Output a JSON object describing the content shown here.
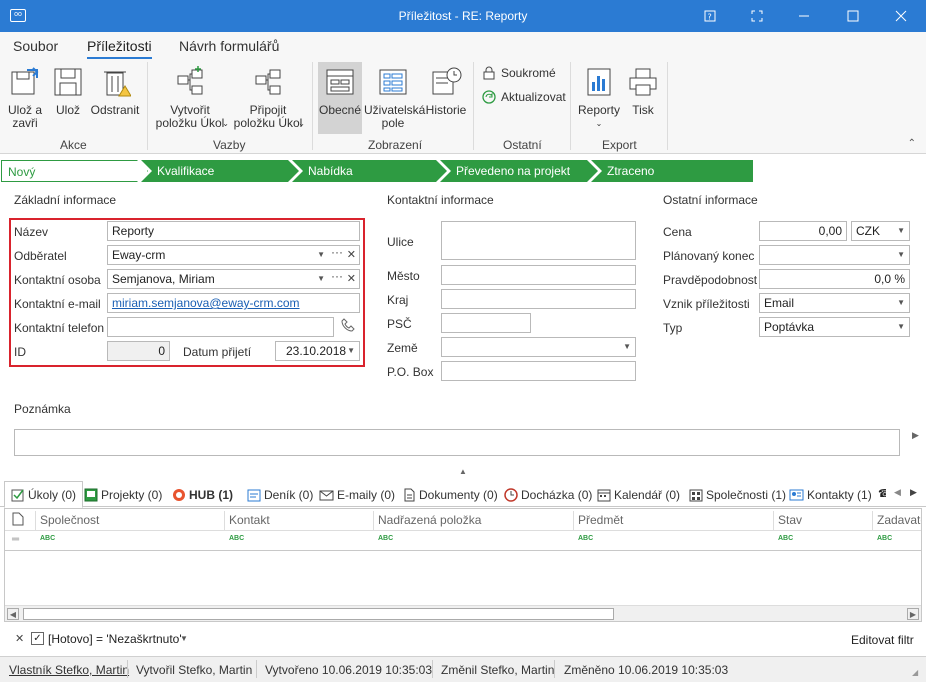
{
  "window": {
    "title": "Příležitost - RE: Reporty"
  },
  "ribbon": {
    "tabs": [
      "Soubor",
      "Příležitosti",
      "Návrh formulářů"
    ],
    "buttons": {
      "save_close": "Ulož a\nzavři",
      "save": "Ulož",
      "delete": "Odstranit",
      "create_task": "Vytvořit\npoložku Úkol",
      "attach_task": "Připojit\npoložku Úkol",
      "general": "Obecné",
      "user_fields": "Uživatelská\npole",
      "history": "Historie",
      "private": "Soukromé",
      "refresh": "Aktualizovat",
      "reports": "Reporty",
      "print": "Tisk"
    },
    "groups": [
      "Akce",
      "Vazby",
      "Zobrazení",
      "Ostatní",
      "Export"
    ]
  },
  "stages": [
    "Nový",
    "Kvalifikace",
    "Nabídka",
    "Převedeno na projekt",
    "Ztraceno"
  ],
  "basic": {
    "section": "Základní informace",
    "name_label": "Název",
    "name_value": "Reporty",
    "customer_label": "Odběratel",
    "customer_value": "Eway-crm",
    "contact_label": "Kontaktní osoba",
    "contact_value": "Semjanova, Miriam",
    "email_label": "Kontaktní e-mail",
    "email_value": "miriam.semjanova@eway-crm.com",
    "phone_label": "Kontaktní telefon",
    "phone_value": "",
    "id_label": "ID",
    "id_value": "0",
    "date_label": "Datum přijetí",
    "date_value": "23.10.2018"
  },
  "contact": {
    "section": "Kontaktní informace",
    "street_label": "Ulice",
    "city_label": "Město",
    "region_label": "Kraj",
    "zip_label": "PSČ",
    "country_label": "Země",
    "pobox_label": "P.O. Box"
  },
  "other": {
    "section": "Ostatní informace",
    "price_label": "Cena",
    "price_value": "0,00",
    "currency": "CZK",
    "end_label": "Plánovaný konec",
    "end_value": "",
    "prob_label": "Pravděpodobnost",
    "prob_value": "0,0 %",
    "origin_label": "Vznik příležitosti",
    "origin_value": "Email",
    "type_label": "Typ",
    "type_value": "Poptávka"
  },
  "note": {
    "label": "Poznámka"
  },
  "bottom_tabs": [
    "Úkoly (0)",
    "Projekty (0)",
    "HUB (1)",
    "Deník (0)",
    "E-maily (0)",
    "Dokumenty (0)",
    "Docházka (0)",
    "Kalendář (0)",
    "Společnosti (1)",
    "Kontakty (1)"
  ],
  "grid": {
    "columns": [
      "Společnost",
      "Kontakt",
      "Nadřazená položka",
      "Předmět",
      "Stav",
      "Zadavate"
    ],
    "abc": "ABC"
  },
  "filter": {
    "text": "[Hotovo] = 'Nezaškrtnuto'",
    "edit": "Editovat filtr"
  },
  "status": {
    "owner": "Vlastník Stefko, Martin",
    "created_by": "Vytvořil Stefko, Martin",
    "created": "Vytvořeno 10.06.2019 10:35:03",
    "changed_by": "Změnil Stefko, Martin",
    "changed": "Změněno 10.06.2019 10:35:03"
  },
  "colors": {
    "accent": "#2b7bd3",
    "stage": "#2e9b42",
    "highlight": "#d9232d"
  }
}
